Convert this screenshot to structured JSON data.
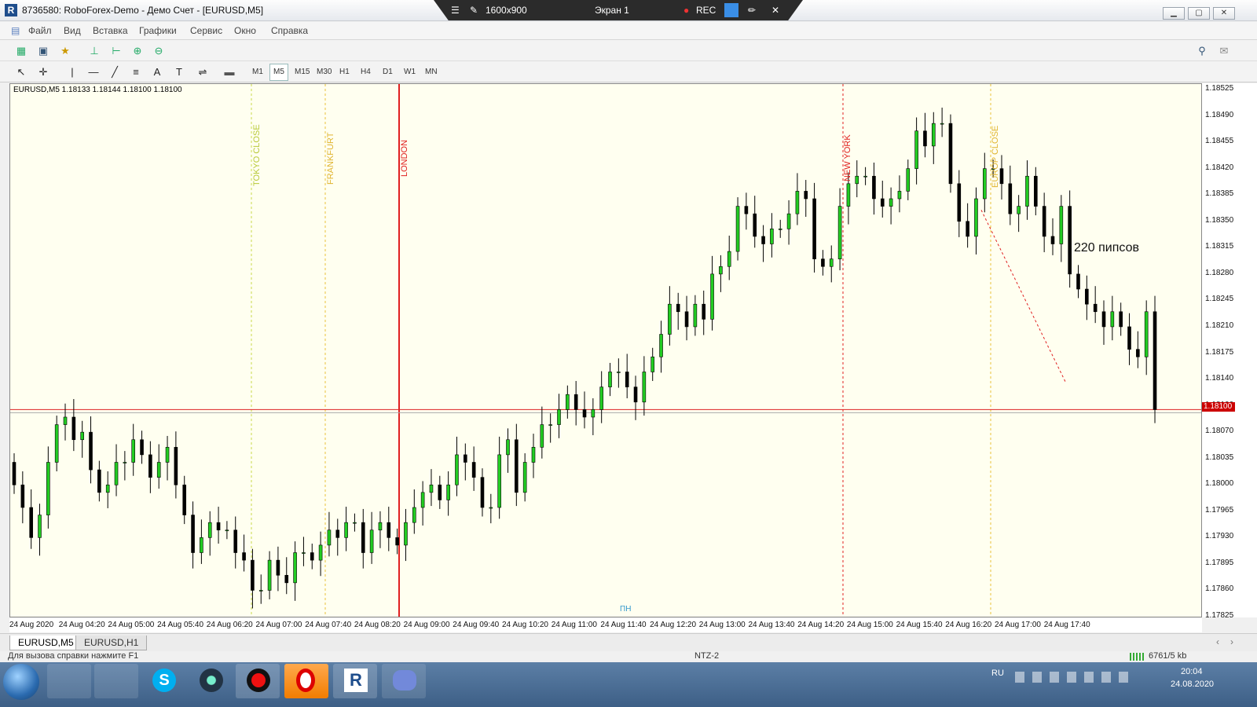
{
  "window": {
    "title": "8736580: RoboForex-Demo - Демо Счет - [EURUSD,M5]",
    "logo_letter": "R",
    "min": "▁",
    "max": "▢",
    "close": "✕"
  },
  "recorder": {
    "resolution": "1600x900",
    "screen": "Экран 1",
    "rec": "REC"
  },
  "menu": [
    "Файл",
    "Вид",
    "Вставка",
    "Графики",
    "Сервис",
    "Окно",
    "Справка"
  ],
  "timeframes": [
    "M1",
    "M5",
    "M15",
    "M30",
    "H1",
    "H4",
    "D1",
    "W1",
    "MN"
  ],
  "active_timeframe": "M5",
  "chart_header": "EURUSD,M5  1.18133 1.18144 1.18100 1.18100",
  "annotation": "220 пипсов",
  "day_marker": "ПН",
  "session_lines": [
    {
      "label": "TOKYO CLOSE",
      "color": "#c8d84a"
    },
    {
      "label": "FRANKFURT",
      "color": "#e8c23a"
    },
    {
      "label": "LONDON",
      "color": "#e02020"
    },
    {
      "label": "NEW YORK",
      "color": "#e02020"
    },
    {
      "label": "EUROP CLOSE",
      "color": "#e8c23a"
    }
  ],
  "price_axis": [
    "1.18525",
    "1.18490",
    "1.18455",
    "1.18420",
    "1.18385",
    "1.18350",
    "1.18315",
    "1.18280",
    "1.18245",
    "1.18210",
    "1.18175",
    "1.18140",
    "1.18100",
    "1.18070",
    "1.18035",
    "1.18000",
    "1.17965",
    "1.17930",
    "1.17895",
    "1.17860",
    "1.17825"
  ],
  "current_price": "1.18100",
  "time_axis": [
    "24 Aug 2020",
    "24 Aug 04:20",
    "24 Aug 05:00",
    "24 Aug 05:40",
    "24 Aug 06:20",
    "24 Aug 07:00",
    "24 Aug 07:40",
    "24 Aug 08:20",
    "24 Aug 09:00",
    "24 Aug 09:40",
    "24 Aug 10:20",
    "24 Aug 11:00",
    "24 Aug 11:40",
    "24 Aug 12:20",
    "24 Aug 13:00",
    "24 Aug 13:40",
    "24 Aug 14:20",
    "24 Aug 15:00",
    "24 Aug 15:40",
    "24 Aug 16:20",
    "24 Aug 17:00",
    "24 Aug 17:40"
  ],
  "tabs": [
    "EURUSD,M5",
    "EURUSD,H1"
  ],
  "active_tab": "EURUSD,M5",
  "status": {
    "help": "Для вызова справки нажмите F1",
    "profile": "NTZ-2",
    "traffic": "6761/5 kb"
  },
  "taskbar": {
    "lang": "RU",
    "time": "20:04",
    "date": "24.08.2020"
  },
  "colors": {
    "bull": "#22cc22",
    "bear": "#000000",
    "chart_bg": "#fffff0"
  },
  "chart_data": {
    "type": "candlestick",
    "symbol": "EURUSD",
    "timeframe": "M5",
    "ylim": [
      1.1781,
      1.1854
    ],
    "closes": [
      1.18,
      1.1797,
      1.1793,
      1.1796,
      1.1803,
      1.1808,
      1.1809,
      1.1806,
      1.1807,
      1.1802,
      1.1799,
      1.18,
      1.1803,
      1.1803,
      1.1806,
      1.1804,
      1.1801,
      1.1803,
      1.1805,
      1.18,
      1.1796,
      1.1791,
      1.1793,
      1.1795,
      1.1794,
      1.1794,
      1.1791,
      1.179,
      1.1786,
      1.1786,
      1.179,
      1.1788,
      1.1787,
      1.1791,
      1.1791,
      1.179,
      1.1792,
      1.1794,
      1.1793,
      1.1795,
      1.1795,
      1.1791,
      1.1794,
      1.1795,
      1.1793,
      1.1792,
      1.1795,
      1.1797,
      1.1799,
      1.18,
      1.1798,
      1.18,
      1.1804,
      1.1803,
      1.1801,
      1.1797,
      1.1797,
      1.1804,
      1.1806,
      1.1799,
      1.1803,
      1.1805,
      1.1808,
      1.1808,
      1.181,
      1.1812,
      1.181,
      1.1809,
      1.181,
      1.1813,
      1.1815,
      1.1815,
      1.1813,
      1.1811,
      1.1815,
      1.1817,
      1.182,
      1.1824,
      1.1823,
      1.1821,
      1.1824,
      1.1822,
      1.1828,
      1.1829,
      1.1831,
      1.1837,
      1.1836,
      1.1833,
      1.1832,
      1.1834,
      1.1834,
      1.1836,
      1.1839,
      1.1838,
      1.183,
      1.1829,
      1.183,
      1.1837,
      1.184,
      1.1841,
      1.1841,
      1.1838,
      1.1837,
      1.1838,
      1.1839,
      1.1842,
      1.1847,
      1.1845,
      1.1848,
      1.1848,
      1.184,
      1.1835,
      1.1833,
      1.1838,
      1.1842,
      1.1842,
      1.184,
      1.1836,
      1.1837,
      1.1841,
      1.1837,
      1.1833,
      1.1832,
      1.1837,
      1.1828,
      1.1826,
      1.1824,
      1.1823,
      1.1821,
      1.1823,
      1.1821,
      1.1818,
      1.1817,
      1.1823,
      1.181
    ]
  }
}
